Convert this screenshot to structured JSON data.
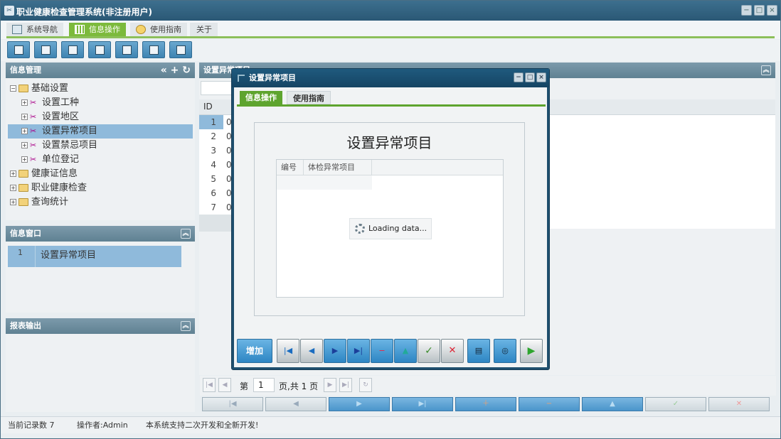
{
  "window": {
    "title": "职业健康检查管理系统(非注册用户)",
    "icon_text": "✂"
  },
  "menu": {
    "tabs": [
      {
        "label": "系统导航"
      },
      {
        "label": "信息操作"
      },
      {
        "label": "使用指南"
      },
      {
        "label": "关于"
      }
    ]
  },
  "panels": {
    "info_mgmt": {
      "title": "信息管理"
    },
    "info_window": {
      "title": "信息窗口"
    },
    "report_output": {
      "title": "报表输出"
    }
  },
  "tree": [
    {
      "label": "基础设置",
      "exp": "−"
    },
    {
      "label": "设置工种",
      "exp": "+"
    },
    {
      "label": "设置地区",
      "exp": "+"
    },
    {
      "label": "设置异常项目",
      "exp": "+"
    },
    {
      "label": "设置禁忌项目",
      "exp": "+"
    },
    {
      "label": "单位登记",
      "exp": "+"
    },
    {
      "label": "健康证信息",
      "exp": "+"
    },
    {
      "label": "职业健康检查",
      "exp": "+"
    },
    {
      "label": "查询统计",
      "exp": "+"
    }
  ],
  "info_window_list": [
    {
      "num": "1",
      "label": "设置异常项目"
    }
  ],
  "main": {
    "title": "设置异常项目",
    "grid_header": {
      "id": "ID"
    },
    "rows": [
      "1",
      "2",
      "3",
      "4",
      "5",
      "6",
      "7"
    ],
    "row_prefix": "0"
  },
  "pager": {
    "page_label": "第",
    "page_value": "1",
    "page_total": "页,共 1 页"
  },
  "status": {
    "records": "当前记录数 7",
    "operator": "操作者:Admin",
    "notice": "本系统支持二次开发和全新开发!"
  },
  "modal": {
    "title": "设置异常项目",
    "tabs": [
      {
        "label": "信息操作"
      },
      {
        "label": "使用指南"
      }
    ],
    "heading": "设置异常项目",
    "columns": [
      "编号",
      "体检异常项目"
    ],
    "loading": "Loading data...",
    "add_label": "增加"
  },
  "colors": {
    "accent_green": "#7cba3c",
    "header_blue": "#2a5875",
    "selection": "#8fbadb"
  }
}
